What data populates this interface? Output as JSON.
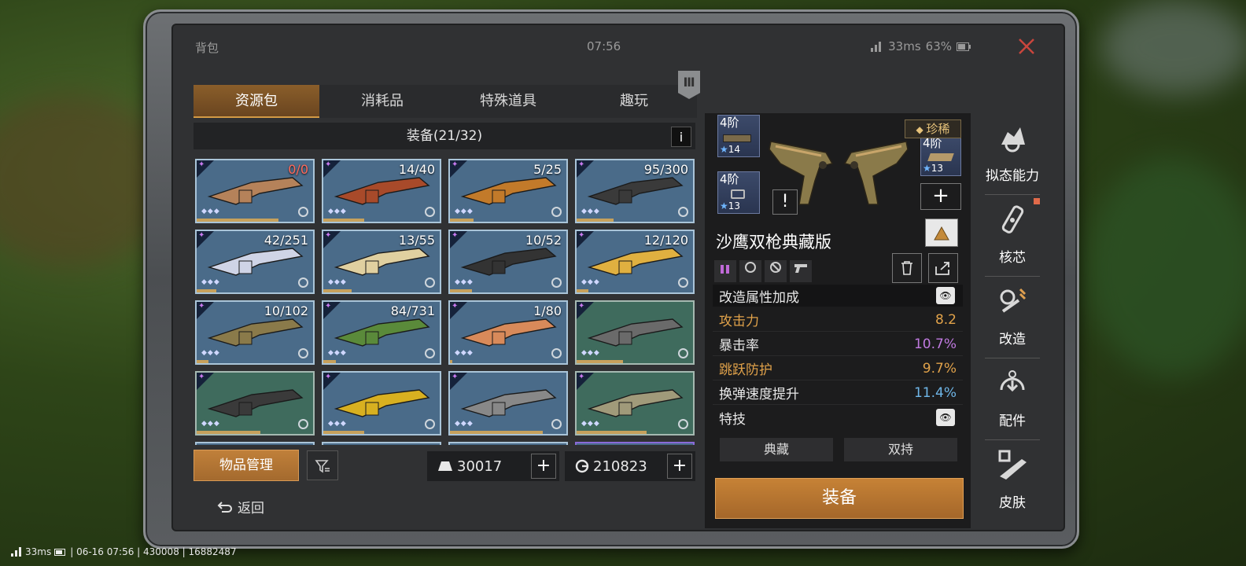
{
  "window": {
    "title": "背包",
    "clock": "07:56",
    "ping": "33ms",
    "battery": "63%"
  },
  "tabs": [
    {
      "label": "资源包",
      "active": true
    },
    {
      "label": "消耗品",
      "active": false
    },
    {
      "label": "特殊道具",
      "active": false
    },
    {
      "label": "趣玩",
      "active": false
    }
  ],
  "inventory": {
    "header": "装备(21/32)",
    "info_label": "i",
    "items": [
      {
        "count": "0/0",
        "count_color": "red",
        "icon": "fishing-rod",
        "rarity": "blue",
        "fill": 0.7
      },
      {
        "count": "14/40",
        "icon": "sniper-rifle",
        "rarity": "blue",
        "fill": 0.35
      },
      {
        "count": "5/25",
        "icon": "gatling-gun",
        "rarity": "blue",
        "fill": 0.2
      },
      {
        "count": "95/300",
        "icon": "assault-rifle",
        "rarity": "blue",
        "fill": 0.32
      },
      {
        "count": "42/251",
        "icon": "plasma-rifle",
        "rarity": "blue",
        "fill": 0.17
      },
      {
        "count": "13/55",
        "icon": "energy-blaster",
        "rarity": "blue",
        "fill": 0.24
      },
      {
        "count": "10/52",
        "icon": "drum-shotgun",
        "rarity": "blue",
        "fill": 0.19
      },
      {
        "count": "12/120",
        "icon": "golden-pistols",
        "rarity": "blue",
        "fill": 0.1
      },
      {
        "count": "10/102",
        "icon": "desert-eagle-dual",
        "rarity": "blue",
        "fill": 0.1
      },
      {
        "count": "84/731",
        "icon": "camo-rifle",
        "rarity": "blue",
        "fill": 0.11
      },
      {
        "count": "1/80",
        "icon": "scorpion-blaster",
        "rarity": "blue",
        "fill": 0.02
      },
      {
        "count": "",
        "icon": "axe",
        "rarity": "green",
        "fill": 0.4
      },
      {
        "count": "",
        "icon": "pickaxe",
        "rarity": "green",
        "fill": 0.55
      },
      {
        "count": "",
        "icon": "chainsaw",
        "rarity": "blue",
        "fill": 0.35
      },
      {
        "count": "",
        "icon": "serrated-sword",
        "rarity": "blue",
        "fill": 0.8
      },
      {
        "count": "",
        "icon": "shovel",
        "rarity": "green",
        "fill": 0.6
      }
    ]
  },
  "bottom": {
    "manage_label": "物品管理",
    "currency_a": "30017",
    "currency_b": "210823",
    "plus_label": "+",
    "back_label": "返回"
  },
  "detail": {
    "mods": [
      {
        "tier": "4阶",
        "stars": "14"
      },
      {
        "tier": "4阶",
        "stars": "13"
      },
      {
        "tier": "4阶",
        "stars": "13"
      }
    ],
    "rarity_label": "珍稀",
    "warn_label": "!",
    "add_label": "+",
    "name": "沙鹰双枪典藏版",
    "stats_header": "改造属性加成",
    "stats": [
      {
        "name": "攻击力",
        "value": "8.2",
        "name_color": "#e1a24a",
        "value_color": "#e1a24a"
      },
      {
        "name": "暴击率",
        "value": "10.7%",
        "name_color": "#e8e8e8",
        "value_color": "#c07ae0"
      },
      {
        "name": "跳跃防护",
        "value": "9.7%",
        "name_color": "#e1a24a",
        "value_color": "#e1a24a"
      },
      {
        "name": "换弹速度提升",
        "value": "11.4%",
        "name_color": "#e8e8e8",
        "value_color": "#6fb6e8"
      }
    ],
    "trait_header": "特技",
    "traits": [
      "典藏",
      "双持"
    ],
    "equip_label": "装备"
  },
  "sidenav": [
    {
      "label": "拟态能力",
      "icon": "mimic-ability-icon"
    },
    {
      "label": "核芯",
      "icon": "core-icon"
    },
    {
      "label": "改造",
      "icon": "modify-icon"
    },
    {
      "label": "配件",
      "icon": "attachment-icon"
    },
    {
      "label": "皮肤",
      "icon": "skin-icon"
    }
  ],
  "hud": {
    "text": "33ms",
    "info": "| 06-16 07:56 | 430008 | 16882487"
  },
  "colors": {
    "accent": "#c68236",
    "cell_blue": "#4a6b89",
    "cell_green": "#3f6b5d",
    "panel": "#303133"
  }
}
